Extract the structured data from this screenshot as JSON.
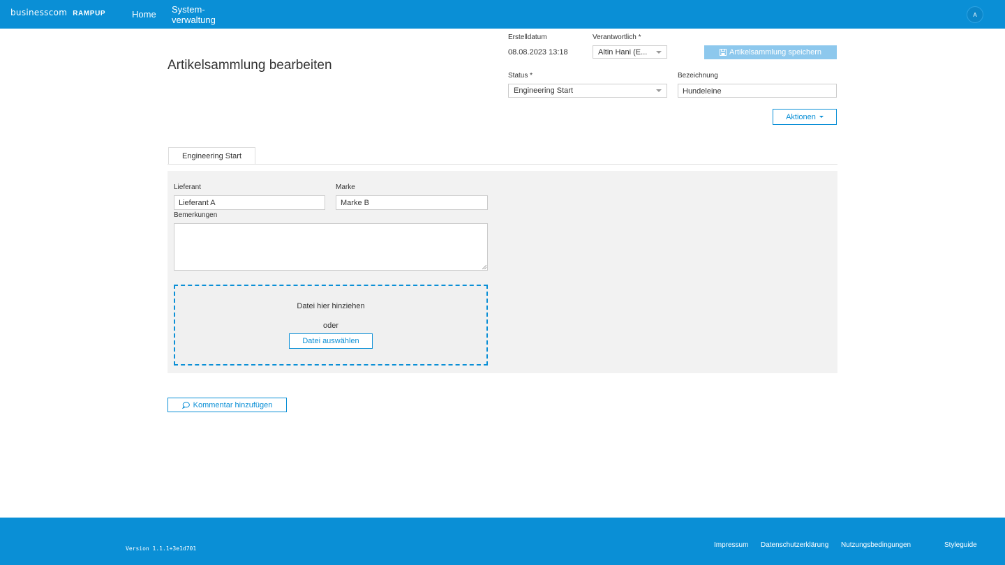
{
  "topbar": {
    "logo_main": "businesscom",
    "logo_sub": "RAMPUP",
    "nav": [
      {
        "label": "Home"
      },
      {
        "label_line1": "System-",
        "label_line2": "verwaltung"
      }
    ],
    "avatar_initial": "A"
  },
  "header": {
    "title": "Artikelsammlung bearbeiten",
    "erstelldatum_label": "Erstelldatum",
    "erstelldatum_value": "08.08.2023 13:18",
    "verantwortlich_label": "Verantwortlich *",
    "verantwortlich_value": "Altin Hani (E...",
    "save_button_label": "Artikelsammlung speichern",
    "status_label": "Status *",
    "status_value": "Engineering Start",
    "bezeichnung_label": "Bezeichnung",
    "bezeichnung_value": "Hundeleine",
    "actions_label": "Aktionen"
  },
  "tabs": [
    {
      "label": "Engineering Start",
      "active": true
    }
  ],
  "form": {
    "lieferant_label": "Lieferant",
    "lieferant_value": "Lieferant A",
    "marke_label": "Marke",
    "marke_value": "Marke B",
    "bemerkungen_label": "Bemerkungen",
    "bemerkungen_value": ""
  },
  "dropzone": {
    "drag_text": "Datei hier hinziehen",
    "or_text": "oder",
    "choose_button": "Datei auswählen"
  },
  "comment_button": "Kommentar hinzufügen",
  "footer": {
    "version": "Version 1.1.1+3e1d701",
    "links": [
      "Impressum",
      "Datenschutzerklärung",
      "Nutzungsbedingungen",
      "Styleguide"
    ]
  },
  "colors": {
    "brand": "#0a8fd6",
    "save_button_disabled": "#8dc8ed",
    "panel_bg": "#f2f2f2"
  }
}
